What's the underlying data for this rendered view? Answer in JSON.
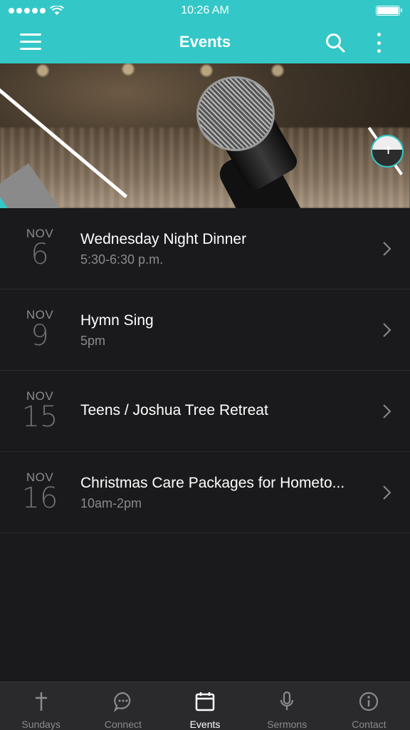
{
  "status_bar": {
    "time": "10:26 AM"
  },
  "nav": {
    "title": "Events"
  },
  "banner": {
    "label": "events"
  },
  "events": [
    {
      "month": "NOV",
      "day": "6",
      "title": "Wednesday Night Dinner",
      "time": "5:30-6:30 p.m."
    },
    {
      "month": "NOV",
      "day": "9",
      "title": "Hymn Sing",
      "time": "5pm"
    },
    {
      "month": "NOV",
      "day": "15",
      "title": "Teens / Joshua Tree Retreat",
      "time": ""
    },
    {
      "month": "NOV",
      "day": "16",
      "title": "Christmas Care Packages for Hometo...",
      "time": "10am-2pm"
    }
  ],
  "tabs": [
    {
      "label": "Sundays",
      "icon": "cross-icon",
      "active": false
    },
    {
      "label": "Connect",
      "icon": "chat-bubble-icon",
      "active": false
    },
    {
      "label": "Events",
      "icon": "calendar-icon",
      "active": true
    },
    {
      "label": "Sermons",
      "icon": "microphone-icon",
      "active": false
    },
    {
      "label": "Contact",
      "icon": "info-icon",
      "active": false
    }
  ],
  "colors": {
    "accent": "#33c7c7",
    "background": "#1a1a1c",
    "tab_bar": "#2a2a2d"
  }
}
